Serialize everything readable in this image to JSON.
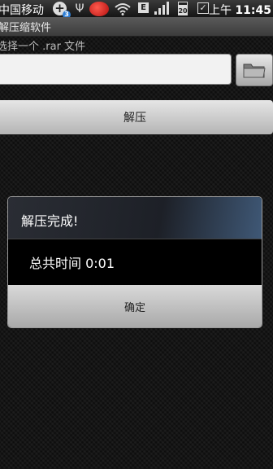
{
  "status_bar": {
    "carrier": "中国移动",
    "notification_count": "3",
    "network_type": "E",
    "battery_level": "20",
    "time_prefix": "上午",
    "time": "11:45",
    "icons": [
      "add-icon",
      "usb-icon",
      "security-shield-icon",
      "wifi-icon",
      "data-e-icon",
      "signal-icon",
      "battery-icon",
      "checkbox-icon"
    ]
  },
  "app": {
    "title": "解压缩软件"
  },
  "form": {
    "hint": "选择一个 .rar 文件",
    "file_path_value": "",
    "browse_icon": "folder-icon",
    "extract_label": "解压"
  },
  "dialog": {
    "title": "解压完成!",
    "message": "总共时间 0:01",
    "ok_label": "确定"
  }
}
